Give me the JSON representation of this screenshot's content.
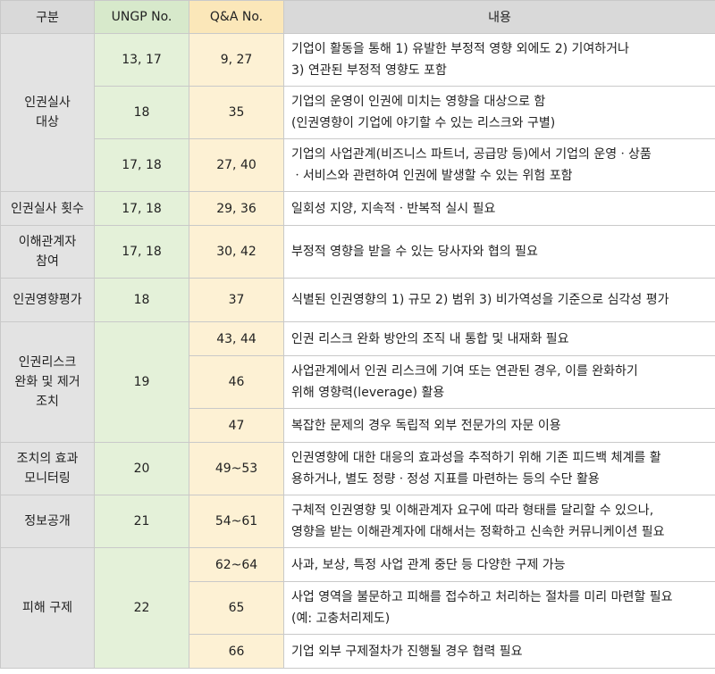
{
  "header": {
    "col1": "구분",
    "col2": "UNGP No.",
    "col3": "Q&A No.",
    "col4": "내용"
  },
  "groups": [
    {
      "category": "인권실사\n대상",
      "rows": [
        {
          "ungp": "13, 17",
          "qa": "9, 27",
          "content": "기업이 활동을 통해 1) 유발한 부정적 영향 외에도 2) 기여하거나\n3) 연관된 부정적 영향도 포함"
        },
        {
          "ungp": "18",
          "qa": "35",
          "content": "기업의 운영이 인권에 미치는 영향을 대상으로 함\n(인권영향이 기업에 야기할 수 있는 리스크와 구별)"
        },
        {
          "ungp": "17, 18",
          "qa": "27, 40",
          "content": "기업의 사업관계(비즈니스 파트너, 공급망 등)에서 기업의 운영ㆍ상품\nㆍ서비스와 관련하여 인권에 발생할 수 있는 위험 포함"
        }
      ]
    },
    {
      "category": "인권실사 횟수",
      "rows": [
        {
          "ungp": "17, 18",
          "qa": "29, 36",
          "content": "일회성 지양, 지속적ㆍ반복적 실시 필요"
        }
      ]
    },
    {
      "category": "이해관계자\n참여",
      "rows": [
        {
          "ungp": "17, 18",
          "qa": "30, 42",
          "content": "부정적 영향을 받을 수 있는 당사자와 협의 필요"
        }
      ]
    },
    {
      "category": "인권영향평가",
      "rows": [
        {
          "ungp": "18",
          "qa": "37",
          "content": "식별된 인권영향의 1) 규모 2) 범위 3) 비가역성을 기준으로 심각성 평가"
        }
      ]
    },
    {
      "category": "인권리스크\n완화 및 제거\n조치",
      "ungp": "19",
      "rows": [
        {
          "qa": "43, 44",
          "content": "인권 리스크 완화 방안의 조직 내 통합 및 내재화 필요"
        },
        {
          "qa": "46",
          "content": "사업관계에서 인권 리스크에 기여 또는 연관된 경우, 이를 완화하기\n위해 영향력(leverage) 활용"
        },
        {
          "qa": "47",
          "content": "복잡한 문제의 경우 독립적 외부 전문가의 자문 이용"
        }
      ]
    },
    {
      "category": "조치의 효과\n모니터링",
      "rows": [
        {
          "ungp": "20",
          "qa": "49~53",
          "content": "인권영향에 대한 대응의 효과성을 추적하기 위해 기존 피드백 체계를 활\n용하거나, 별도 정량ㆍ정성 지표를 마련하는 등의 수단 활용"
        }
      ]
    },
    {
      "category": "정보공개",
      "rows": [
        {
          "ungp": "21",
          "qa": "54~61",
          "content": "구체적 인권영향 및 이해관계자 요구에 따라 형태를 달리할 수 있으나,\n영향을 받는 이해관계자에 대해서는 정확하고 신속한 커뮤니케이션 필요"
        }
      ]
    },
    {
      "category": "피해 구제",
      "ungp": "22",
      "rows": [
        {
          "qa": "62~64",
          "content": "사과, 보상, 특정 사업 관계 중단 등 다양한 구제 가능"
        },
        {
          "qa": "65",
          "content": "사업 영역을 불문하고 피해를 접수하고 처리하는 절차를 미리 마련할 필요\n(예: 고충처리제도)"
        },
        {
          "qa": "66",
          "content": "기업 외부 구제절차가 진행될 경우 협력 필요"
        }
      ]
    }
  ]
}
